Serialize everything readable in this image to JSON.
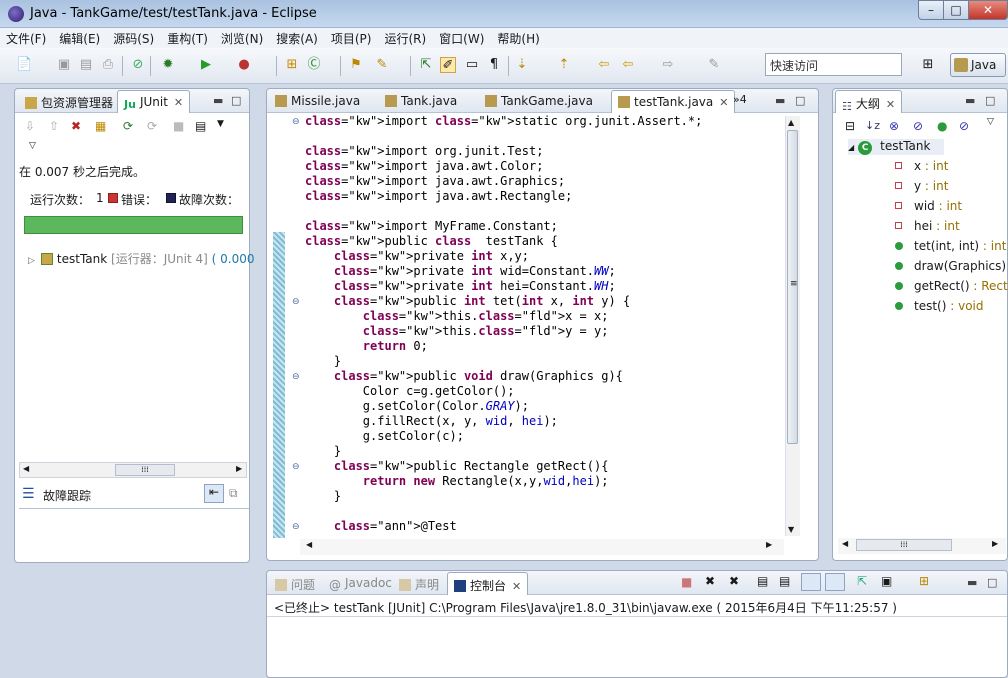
{
  "window": {
    "title": "Java  -  TankGame/test/testTank.java  -  Eclipse",
    "buttons": {
      "minimize": "–",
      "maximize": "□",
      "close": "✕"
    }
  },
  "menu": [
    "文件(F)",
    "编辑(E)",
    "源码(S)",
    "重构(T)",
    "浏览(N)",
    "搜索(A)",
    "项目(P)",
    "运行(R)",
    "窗口(W)",
    "帮助(H)"
  ],
  "toolbar": {
    "quick_access": "快速访问",
    "perspective": "Java"
  },
  "left": {
    "tabs": {
      "package_explorer": "包资源管理器",
      "junit": "JUnit"
    },
    "status": "在 0.007 秒之后完成。",
    "runs_label": "运行次数：",
    "runs_value": "1",
    "errors_label": "错误：",
    "failures_label": "故障次数：",
    "test_node": "testTank",
    "test_node_detail": "[运行器：JUnit 4]",
    "test_node_time": "( 0.000",
    "failure_trace": "故障跟踪",
    "progress_ok": true
  },
  "editor": {
    "tabs": [
      "Missile.java",
      "Tank.java",
      "TankGame.java",
      "testTank.java"
    ],
    "active_tab": "testTank.java",
    "overflow": "»4",
    "code_lines": [
      "import static org.junit.Assert.*;",
      "",
      "import org.junit.Test;",
      "import java.awt.Color;",
      "import java.awt.Graphics;",
      "import java.awt.Rectangle;",
      "",
      "import MyFrame.Constant;",
      "public class  testTank {",
      "    private int x,y;",
      "    private int wid=Constant.WW;",
      "    private int hei=Constant.WH;",
      "    public int tet(int x, int y) {",
      "        this.x = x;",
      "        this.y = y;",
      "        return 0;",
      "    }",
      "    public void draw(Graphics g){",
      "        Color c=g.getColor();",
      "        g.setColor(Color.GRAY);",
      "        g.fillRect(x, y, wid, hei);",
      "        g.setColor(c);",
      "    }",
      "    public Rectangle getRect(){",
      "        return new Rectangle(x,y,wid,hei);",
      "    }",
      "",
      "    @Test"
    ]
  },
  "outline": {
    "tab": "大纲",
    "class_name": "testTank",
    "members": [
      {
        "name": "x",
        "type": " : int",
        "kind": "field"
      },
      {
        "name": "y",
        "type": " : int",
        "kind": "field"
      },
      {
        "name": "wid",
        "type": " : int",
        "kind": "field"
      },
      {
        "name": "hei",
        "type": " : int",
        "kind": "field"
      },
      {
        "name": "tet(int, int)",
        "type": " : int",
        "kind": "method"
      },
      {
        "name": "draw(Graphics)",
        "type": " : void",
        "kind": "method"
      },
      {
        "name": "getRect()",
        "type": " : Rect",
        "kind": "method"
      },
      {
        "name": "test()",
        "type": " : void",
        "kind": "method"
      }
    ]
  },
  "console": {
    "tabs": [
      "问题",
      "Javadoc",
      "声明",
      "控制台"
    ],
    "active_tab": "控制台",
    "line": "<已终止> testTank [JUnit] C:\\Program Files\\Java\\jre1.8.0_31\\bin\\javaw.exe ( 2015年6月4日 下午11:25:57 )"
  },
  "colors": {
    "progress": "#5cb85c",
    "keyword": "#7f0055",
    "field": "#0000c0"
  }
}
